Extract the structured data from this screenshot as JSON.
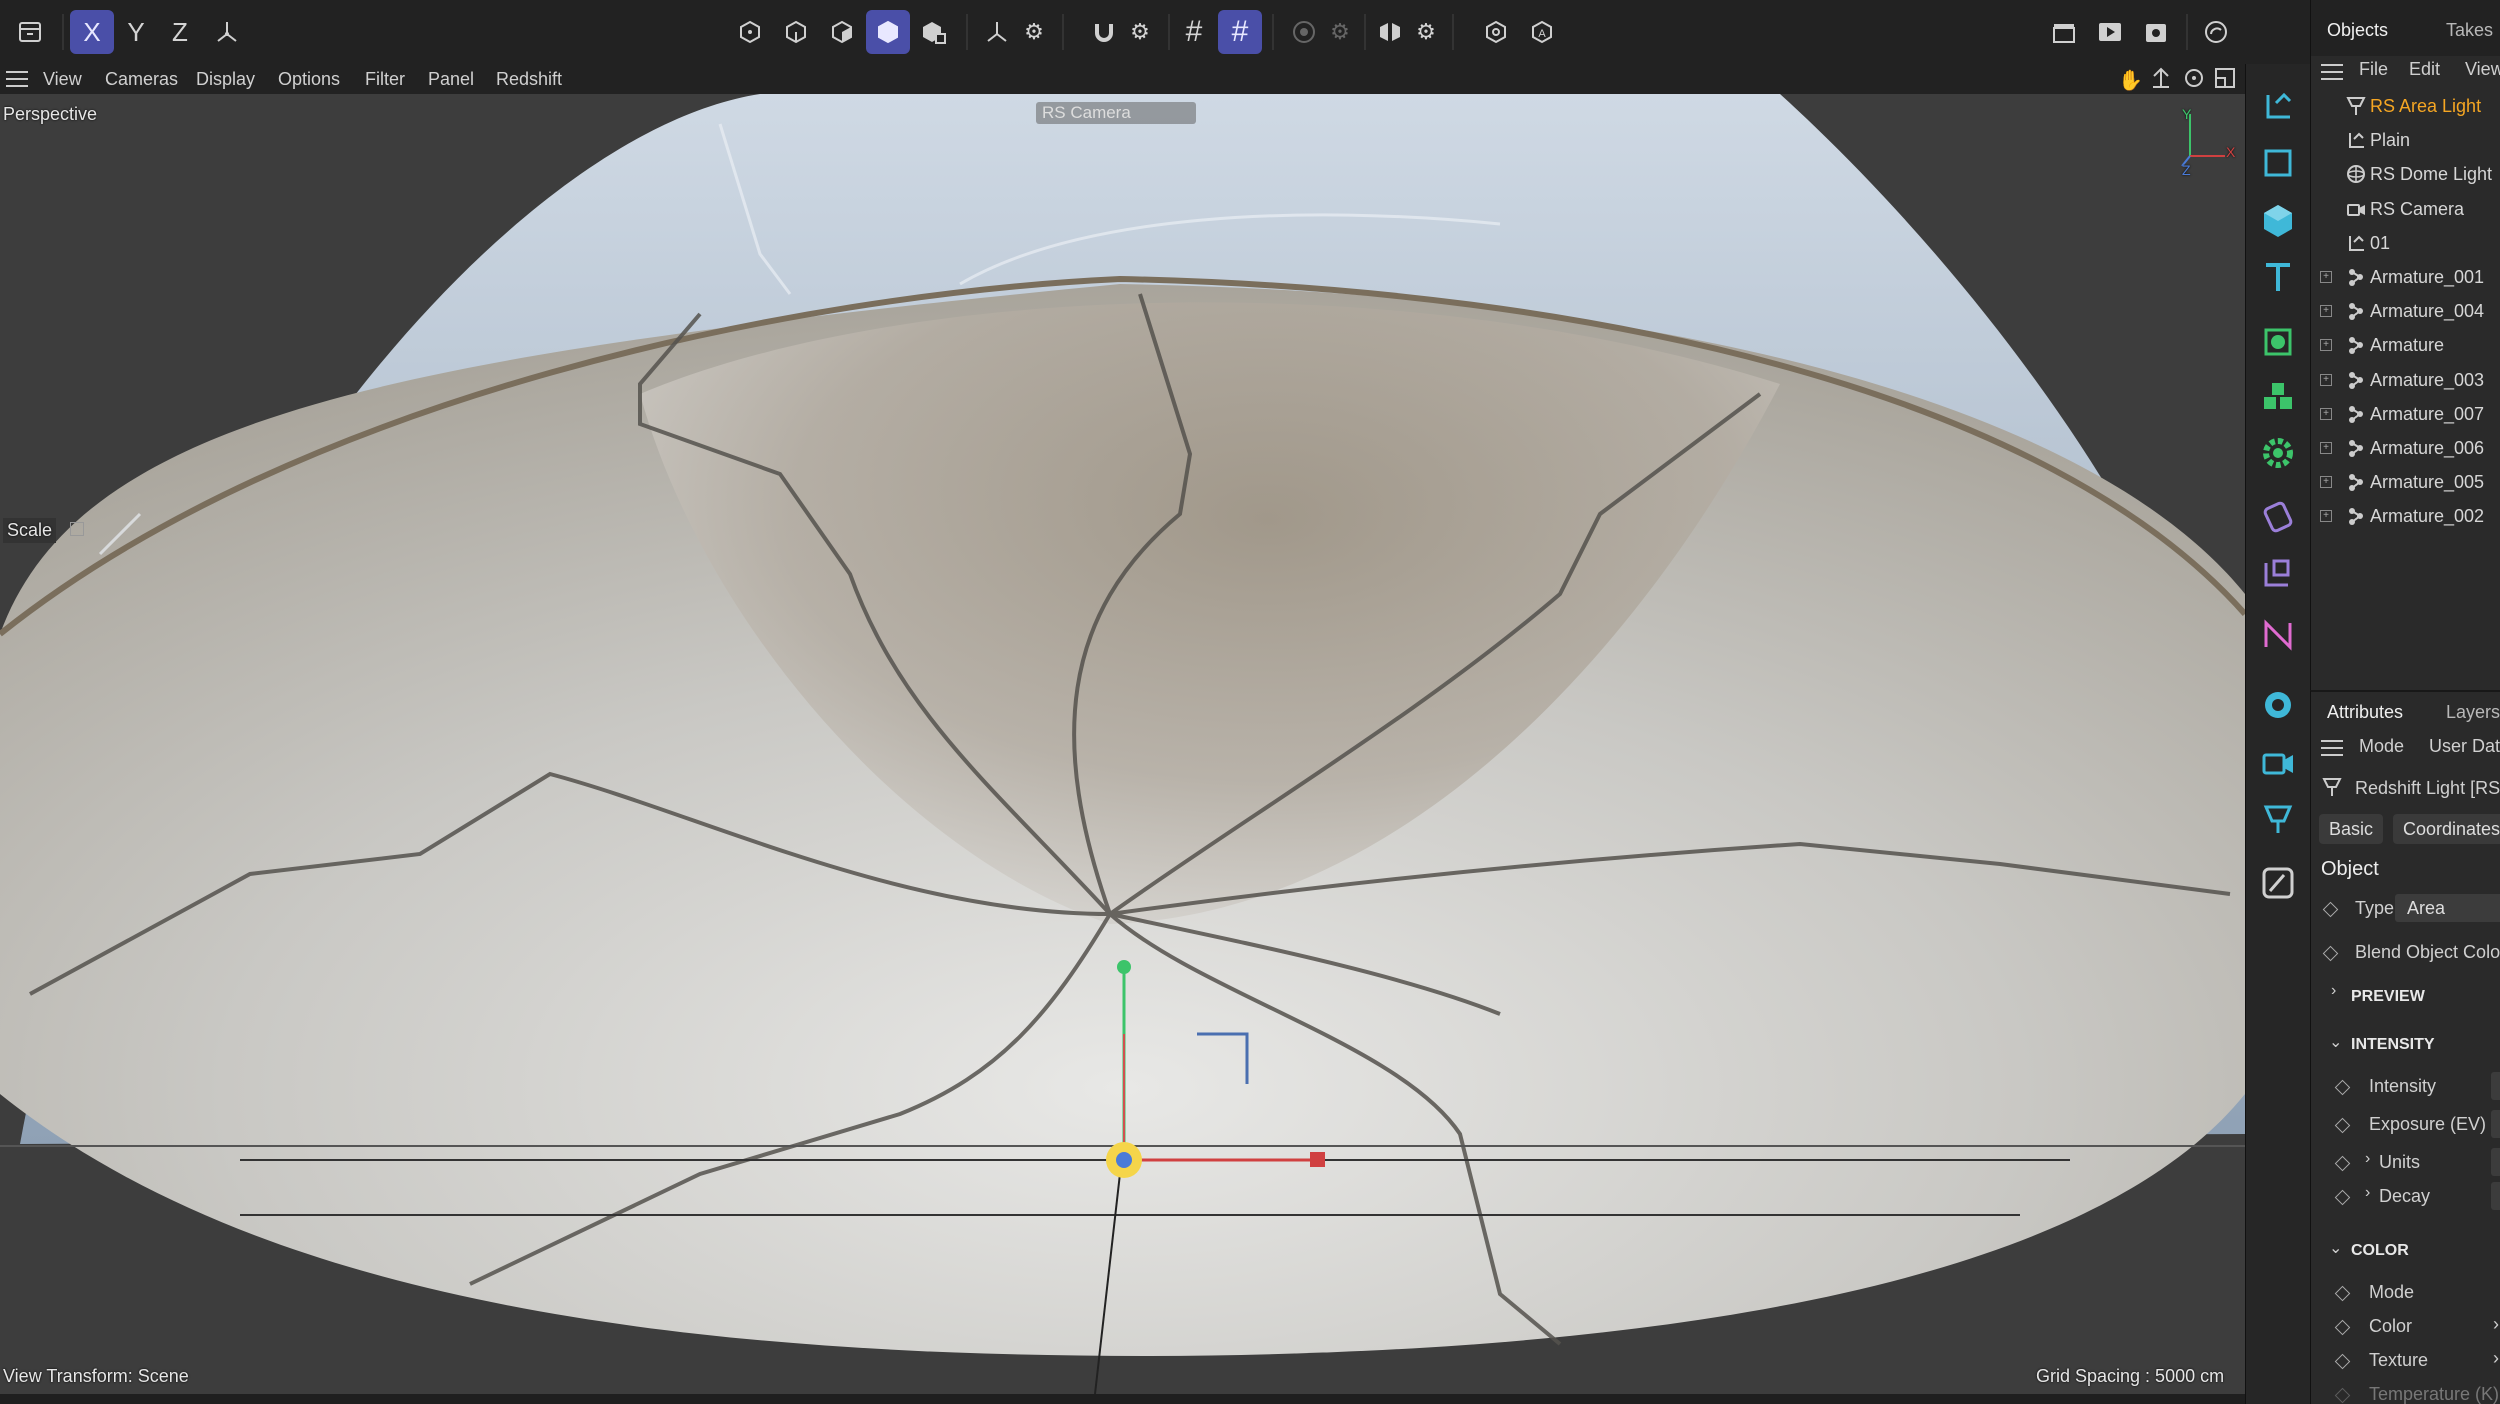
{
  "toolbar": {
    "axis_x": "X",
    "axis_y": "Y",
    "axis_z": "Z"
  },
  "viewport_menu": {
    "items": [
      "View",
      "Cameras",
      "Display",
      "Options",
      "Filter",
      "Panel",
      "Redshift"
    ]
  },
  "viewport": {
    "projection_label": "Perspective",
    "camera_label": "RS Camera",
    "hud_scale_label": "Scale",
    "view_transform": "View Transform: Scene",
    "grid_spacing": "Grid Spacing : 5000 cm",
    "axis_labels": {
      "y": "Y",
      "x": "X",
      "z": "Z"
    }
  },
  "objects_panel": {
    "tabs": [
      "Objects",
      "Takes"
    ],
    "menu": [
      "File",
      "Edit",
      "View"
    ],
    "items": [
      {
        "name": "RS Area Light",
        "icon": "light-icon",
        "selected": true,
        "expandable": false
      },
      {
        "name": "Plain",
        "icon": "null-icon",
        "selected": false,
        "expandable": false
      },
      {
        "name": "RS Dome Light",
        "icon": "dome-light-icon",
        "selected": false,
        "expandable": false
      },
      {
        "name": "RS Camera",
        "icon": "camera-icon",
        "selected": false,
        "expandable": false
      },
      {
        "name": "01",
        "icon": "null-icon",
        "selected": false,
        "expandable": false
      },
      {
        "name": "Armature_001",
        "icon": "armature-icon",
        "selected": false,
        "expandable": true
      },
      {
        "name": "Armature_004",
        "icon": "armature-icon",
        "selected": false,
        "expandable": true
      },
      {
        "name": "Armature",
        "icon": "armature-icon",
        "selected": false,
        "expandable": true
      },
      {
        "name": "Armature_003",
        "icon": "armature-icon",
        "selected": false,
        "expandable": true
      },
      {
        "name": "Armature_007",
        "icon": "armature-icon",
        "selected": false,
        "expandable": true
      },
      {
        "name": "Armature_006",
        "icon": "armature-icon",
        "selected": false,
        "expandable": true
      },
      {
        "name": "Armature_005",
        "icon": "armature-icon",
        "selected": false,
        "expandable": true
      },
      {
        "name": "Armature_002",
        "icon": "armature-icon",
        "selected": false,
        "expandable": true
      }
    ]
  },
  "attributes_panel": {
    "tabs": [
      "Attributes",
      "Layers"
    ],
    "menu": [
      "Mode",
      "User Data"
    ],
    "object_title": "Redshift Light [RS",
    "sub_tabs": [
      "Basic",
      "Coordinates"
    ],
    "section_object": "Object",
    "type_label": "Type",
    "type_value": "Area",
    "blend_label": "Blend Object Colo",
    "section_preview": "PREVIEW",
    "section_intensity": "INTENSITY",
    "intensity_label": "Intensity",
    "exposure_label": "Exposure (EV)",
    "units_label": "Units",
    "decay_label": "Decay",
    "section_color": "COLOR",
    "color_mode_label": "Mode",
    "color_label": "Color",
    "texture_label": "Texture",
    "temperature_label": "Temperature (K)"
  },
  "colors": {
    "accent_active": "#4a4fa8",
    "selected_text": "#f5a623",
    "icon_cyan": "#3fb8d8",
    "icon_green": "#3cc46a",
    "icon_purple": "#9b7fd9",
    "icon_pink": "#e06bd0"
  }
}
